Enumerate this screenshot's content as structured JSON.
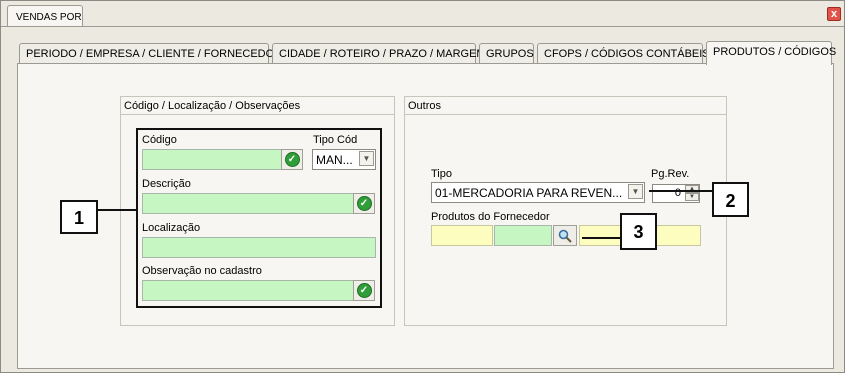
{
  "window": {
    "title": "VENDAS POR",
    "close_glyph": "x"
  },
  "tabs": [
    {
      "label": "PERIODO / EMPRESA / CLIENTE / FORNECEDOR"
    },
    {
      "label": "CIDADE / ROTEIRO / PRAZO / MARGEM"
    },
    {
      "label": "GRUPOS"
    },
    {
      "label": "CFOPS / CÓDIGOS CONTÁBEIS"
    },
    {
      "label": "PRODUTOS / CÓDIGOS"
    }
  ],
  "left_group": {
    "title": "Código / Localização / Observações",
    "codigo_label": "Código",
    "tipo_cod_label": "Tipo Cód",
    "tipo_cod_value": "MAN...",
    "descricao_label": "Descrição",
    "localizacao_label": "Localização",
    "observacao_label": "Observação no cadastro"
  },
  "right_group": {
    "title": "Outros",
    "tipo_label": "Tipo",
    "tipo_value": "01-MERCADORIA PARA REVEN...",
    "pgrev_label": "Pg.Rev.",
    "pgrev_value": "0",
    "produtos_fornecedor_label": "Produtos do Fornecedor"
  },
  "callouts": {
    "one": "1",
    "two": "2",
    "three": "3"
  },
  "colors": {
    "field_green": "#c6f7c3",
    "field_yellow": "#fdfdc0",
    "ok_icon": "#2f9e38",
    "close_button": "#e0534a"
  }
}
